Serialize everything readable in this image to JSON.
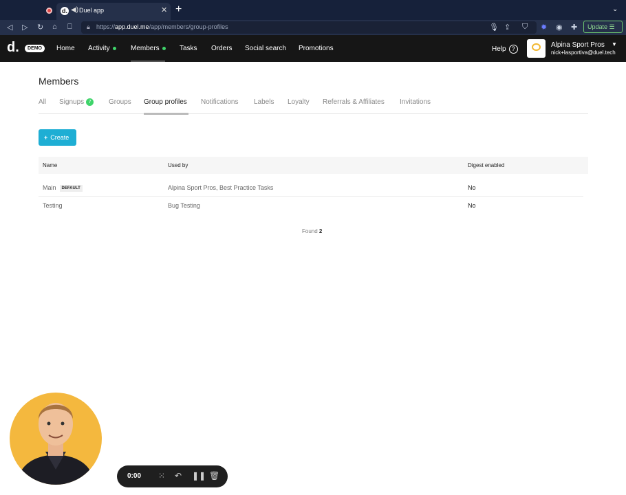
{
  "browser": {
    "tab_title": "Duel app",
    "tab_favicon": "d.",
    "url_prefix": "https://",
    "url_domain": "app.duel.me",
    "url_path": "/app/members/group-profiles",
    "update_label": "Update"
  },
  "app": {
    "logo": "d.",
    "demo_badge": "DEMO",
    "nav": [
      {
        "label": "Home"
      },
      {
        "label": "Activity"
      },
      {
        "label": "Members"
      },
      {
        "label": "Tasks"
      },
      {
        "label": "Orders"
      },
      {
        "label": "Social search"
      },
      {
        "label": "Promotions"
      }
    ],
    "help_label": "Help",
    "org_name": "Alpina Sport Pros",
    "org_email": "nick+lasportiva@duel.tech"
  },
  "page": {
    "title": "Members",
    "subtabs": [
      {
        "label": "All"
      },
      {
        "label": "Signups",
        "badge": "7"
      },
      {
        "label": "Groups"
      },
      {
        "label": "Group profiles"
      },
      {
        "label": "Notifications"
      },
      {
        "label": "Labels"
      },
      {
        "label": "Loyalty"
      },
      {
        "label": "Referrals & Affiliates"
      },
      {
        "label": "Invitations"
      }
    ],
    "create_label": "Create",
    "table": {
      "headers": [
        "Name",
        "Used by",
        "Digest enabled"
      ],
      "rows": [
        {
          "name": "Main",
          "tag": "DEFAULT",
          "used_by": "Alpina Sport Pros,  Best Practice Tasks",
          "digest": "No"
        },
        {
          "name": "Testing",
          "tag": "",
          "used_by": "Bug Testing",
          "digest": "No"
        }
      ]
    },
    "found_label": "Found",
    "found_count": "2"
  },
  "recorder": {
    "time": "0:00"
  },
  "colors": {
    "accent": "#1eaed4",
    "status_green": "#3fd46a",
    "header_bg": "#161616"
  }
}
